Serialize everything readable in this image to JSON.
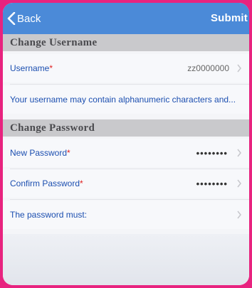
{
  "navbar": {
    "back_label": "Back",
    "submit_label": "Submit"
  },
  "username_section": {
    "title": "Change Username",
    "username_label": "Username",
    "username_value": "zz0000000",
    "hint": "Your username may contain alphanumeric characters and..."
  },
  "password_section": {
    "title": "Change Password",
    "new_password_label": "New Password",
    "new_password_value": "••••••••",
    "confirm_password_label": "Confirm Password",
    "confirm_password_value": "••••••••",
    "rules_label": "The password must:"
  },
  "required_mark": "*",
  "colors": {
    "accent": "#4b8ad8",
    "link_text": "#1c4fb0",
    "required": "#e02020",
    "border": "#e8237f"
  }
}
